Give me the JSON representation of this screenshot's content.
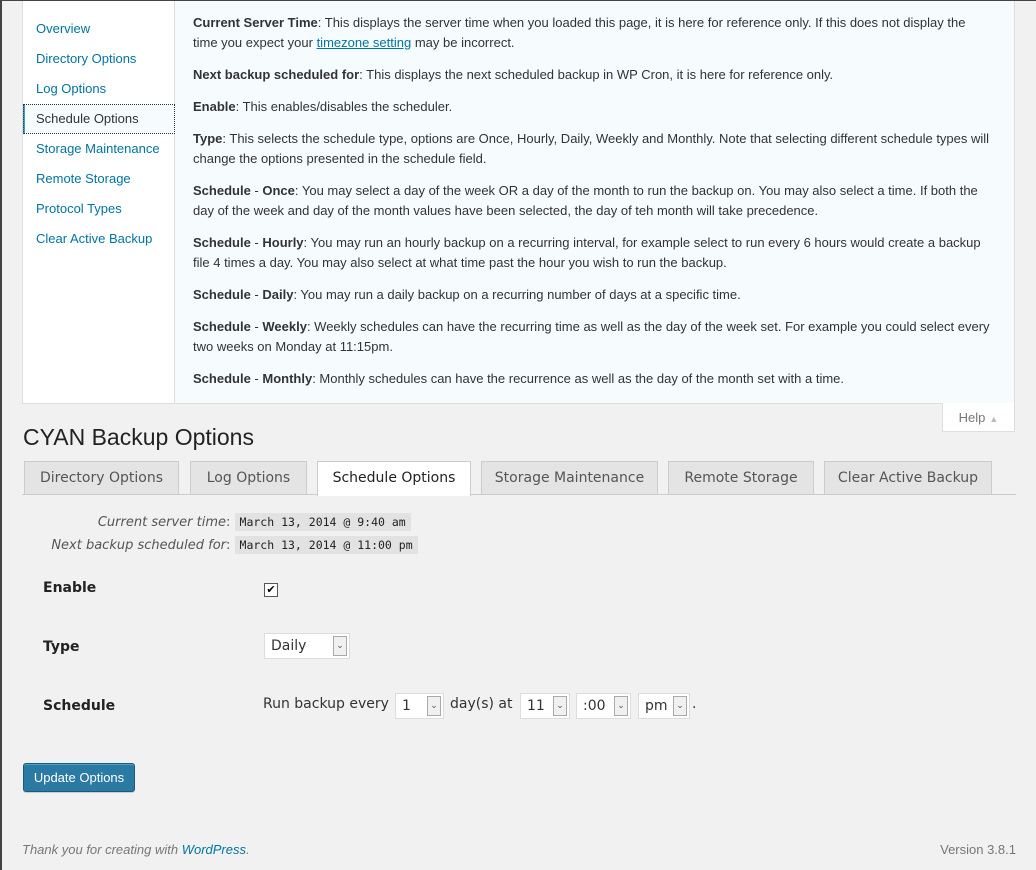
{
  "help": {
    "tabs": [
      {
        "label": "Overview",
        "active": false
      },
      {
        "label": "Directory Options",
        "active": false
      },
      {
        "label": "Log Options",
        "active": false
      },
      {
        "label": "Schedule Options",
        "active": true
      },
      {
        "label": "Storage Maintenance",
        "active": false
      },
      {
        "label": "Remote Storage",
        "active": false
      },
      {
        "label": "Protocol Types",
        "active": false
      },
      {
        "label": "Clear Active Backup",
        "active": false
      }
    ],
    "content": [
      {
        "term": "Current Server Time",
        "text_before": ": This displays the server time when you loaded this page, it is here for reference only. If this does not display the time you expect your ",
        "link": "timezone setting",
        "text_after": " may be incorrect."
      },
      {
        "term": "Next backup scheduled for",
        "text": ": This displays the next scheduled backup in WP Cron, it is here for reference only."
      },
      {
        "term": "Enable",
        "text": ": This enables/disables the scheduler."
      },
      {
        "term": "Type",
        "text": ": This selects the schedule type, options are Once, Hourly, Daily, Weekly and Monthly. Note that selecting different schedule types will change the options presented in the schedule field."
      },
      {
        "term_prefix": "Schedule",
        "term": "Once",
        "text": ": You may select a day of the week OR a day of the month to run the backup on. You may also select a time. If both the day of the week and day of the month values have been selected, the day of teh month will take precedence."
      },
      {
        "term_prefix": "Schedule",
        "term": "Hourly",
        "text": ": You may run an hourly backup on a recurring interval, for example select to run every 6 hours would create a backup file 4 times a day. You may also select at what time past the hour you wish to run the backup."
      },
      {
        "term_prefix": "Schedule",
        "term": "Daily",
        "text": ": You may run a daily backup on a recurring number of days at a specific time."
      },
      {
        "term_prefix": "Schedule",
        "term": "Weekly",
        "text": ": Weekly schedules can have the recurring time as well as the day of the week set. For example you could select every two weeks on Monday at 11:15pm."
      },
      {
        "term_prefix": "Schedule",
        "term": "Monthly",
        "text": ": Monthly schedules can have the recurrence as well as the day of the month set with a time."
      }
    ],
    "dash": " - ",
    "toggle_label": "Help",
    "toggle_icon": "▲"
  },
  "page": {
    "title": "CYAN Backup Options"
  },
  "tabs": [
    {
      "label": "Directory Options",
      "active": false
    },
    {
      "label": "Log Options",
      "active": false
    },
    {
      "label": "Schedule Options",
      "active": true
    },
    {
      "label": "Storage Maintenance",
      "active": false
    },
    {
      "label": "Remote Storage",
      "active": false
    },
    {
      "label": "Clear Active Backup",
      "active": false
    }
  ],
  "info": {
    "current_time_label": "Current server time",
    "current_time_value": "March 13, 2014 @ 9:40 am",
    "next_backup_label": "Next backup scheduled for",
    "next_backup_value": "March 13, 2014 @ 11:00 pm",
    "colon": ":"
  },
  "form": {
    "enable_label": "Enable",
    "enable_checked": true,
    "checkmark": "✔",
    "type_label": "Type",
    "type_value": "Daily",
    "schedule_label": "Schedule",
    "run_every_text": "Run backup every",
    "days_value": "1",
    "days_at_text": "day(s) at",
    "hour_value": "11",
    "minute_value": ":00",
    "ampm_value": "pm",
    "period": ".",
    "dropdown_icon": "⌄"
  },
  "actions": {
    "update_label": "Update Options"
  },
  "footer": {
    "thanks_prefix": "Thank you for creating with ",
    "wordpress_link": "WordPress",
    "thanks_suffix": ".",
    "version": "Version 3.8.1"
  }
}
